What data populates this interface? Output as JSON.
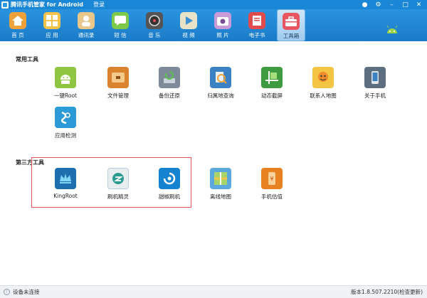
{
  "window": {
    "title": "腾讯手机管家 for Android",
    "login": "登录",
    "buttons": [
      "shirt-icon",
      "gear-icon",
      "minimize-icon",
      "maximize-icon",
      "close-icon"
    ]
  },
  "nav": {
    "items": [
      {
        "label": "首 页",
        "icon": "home-icon",
        "color": "#f0a23a"
      },
      {
        "label": "应 用",
        "icon": "apps-icon",
        "color": "#f2c24a"
      },
      {
        "label": "通讯录",
        "icon": "contacts-icon",
        "color": "#e9c68a"
      },
      {
        "label": "短 信",
        "icon": "sms-icon",
        "color": "#7fc94a"
      },
      {
        "label": "音 乐",
        "icon": "music-icon",
        "color": "#555555"
      },
      {
        "label": "视 频",
        "icon": "video-icon",
        "color": "#e8e2c8"
      },
      {
        "label": "照 片",
        "icon": "photo-icon",
        "color": "#c79ad8"
      },
      {
        "label": "电子书",
        "icon": "ebook-icon",
        "color": "#e04b4b"
      },
      {
        "label": "工具箱",
        "icon": "toolbox-icon",
        "color": "#e8545f"
      }
    ],
    "active_index": 8
  },
  "sections": {
    "common_title": "常用工具",
    "third_title": "第三方工具"
  },
  "common_tools": [
    {
      "label": "一键Root",
      "icon": "android-root-icon",
      "color": "#8ec641"
    },
    {
      "label": "文件管理",
      "icon": "folder-icon",
      "color": "#d9832e"
    },
    {
      "label": "备份还原",
      "icon": "backup-icon",
      "color": "#7c8a99"
    },
    {
      "label": "归属地查询",
      "icon": "location-search-icon",
      "color": "#3b82c4"
    },
    {
      "label": "动态截屏",
      "icon": "screenshot-icon",
      "color": "#3f9b3f"
    },
    {
      "label": "联系人地图",
      "icon": "contacts-map-icon",
      "color": "#f4c543"
    },
    {
      "label": "关于手机",
      "icon": "phone-info-icon",
      "color": "#5c6e80"
    },
    {
      "label": "应用检测",
      "icon": "app-check-icon",
      "color": "#2b9ad6"
    }
  ],
  "third_tools": [
    {
      "label": "KingRoot",
      "icon": "crown-icon",
      "color": "#1d6fae"
    },
    {
      "label": "刷机精灵",
      "icon": "flash-spirit-icon",
      "color": "#2a9b8e"
    },
    {
      "label": "甜椒刷机",
      "icon": "refresh-icon",
      "color": "#1583cf"
    },
    {
      "label": "离线地图",
      "icon": "offline-map-icon",
      "color": "#5aa8dd"
    },
    {
      "label": "手机估值",
      "icon": "phone-value-icon",
      "color": "#e8811f"
    }
  ],
  "status": {
    "connection": "设备未连接",
    "version": "版本1.8.507.2210(检查更新)"
  }
}
